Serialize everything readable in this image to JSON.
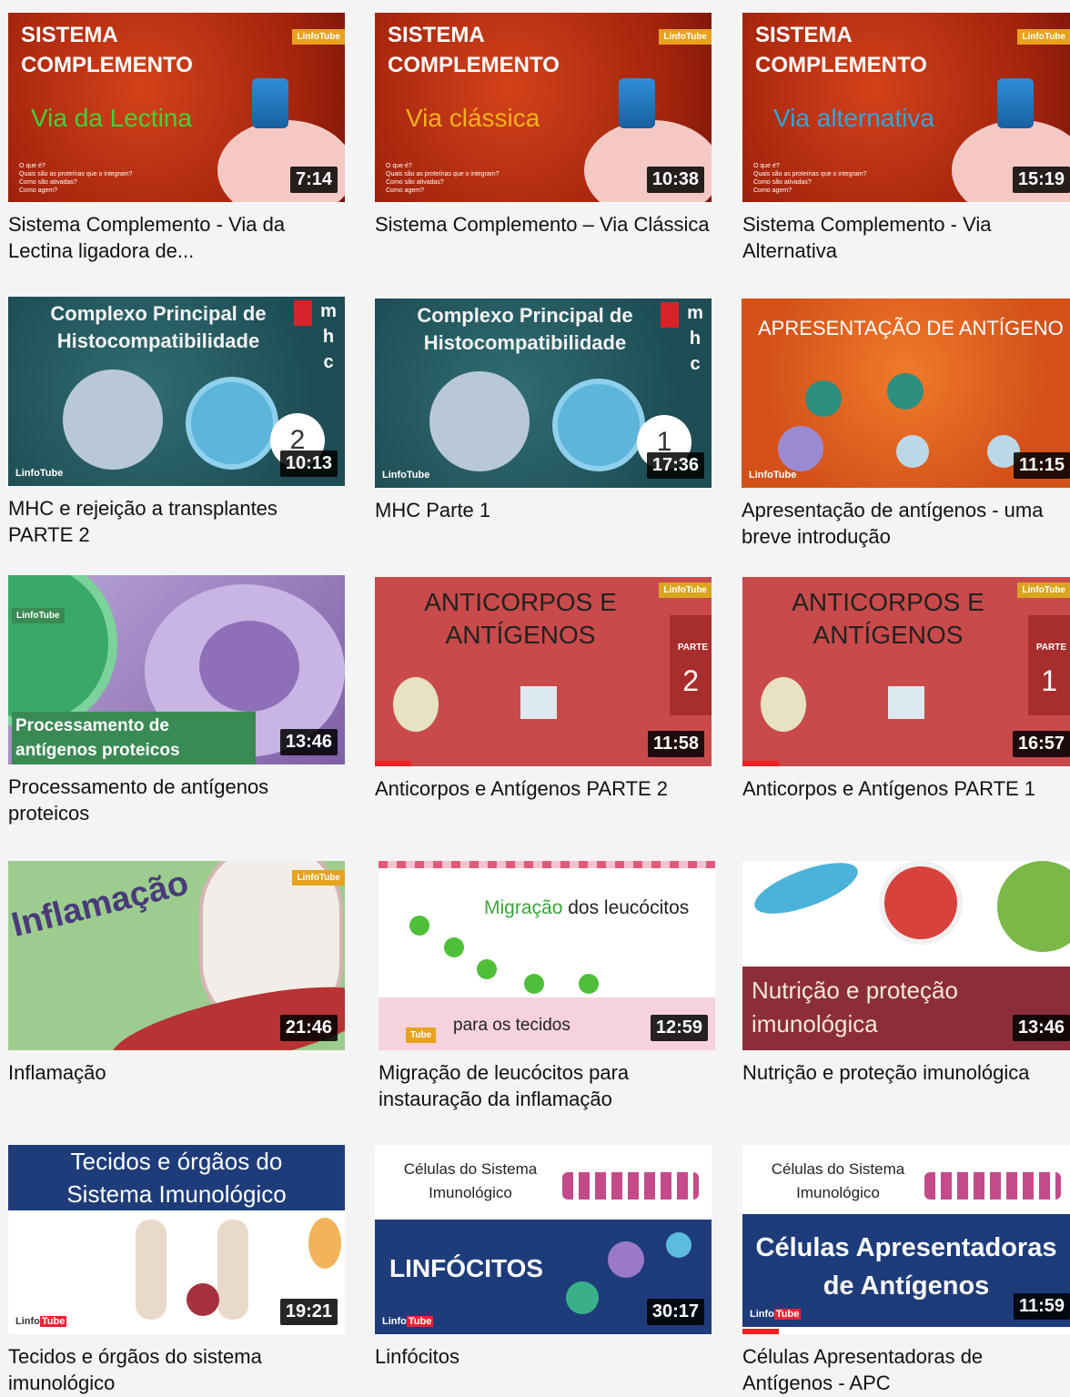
{
  "videos": [
    {
      "title": "Sistema Complemento - Via da Lectina ligadora de...",
      "duration": "7:14",
      "thumb_heading": "SISTEMA COMPLEMENTO",
      "thumb_sub": "Via da Lectina",
      "thumb_bullets": [
        "O que é?",
        "Quais são as proteínas que o integram?",
        "Como são ativadas?",
        "Como agem?"
      ]
    },
    {
      "title": "Sistema Complemento – Via Clássica",
      "duration": "10:38",
      "thumb_heading": "SISTEMA COMPLEMENTO",
      "thumb_sub": "Via clássica",
      "thumb_bullets": [
        "O que é?",
        "Quais são as proteínas que o integram?",
        "Como são ativadas?",
        "Como agem?"
      ]
    },
    {
      "title": "Sistema Complemento - Via Alternativa",
      "duration": "15:19",
      "thumb_heading": "SISTEMA COMPLEMENTO",
      "thumb_sub": "Via alternativa",
      "thumb_bullets": [
        "O que é?",
        "Quais são as proteínas que o integram?",
        "Como são ativadas?",
        "Como agem?"
      ]
    },
    {
      "title": "MHC e rejeição a transplantes PARTE 2",
      "duration": "10:13",
      "thumb_heading": "Complexo Principal de Histocompatibilidade",
      "thumb_side": "m h c",
      "thumb_num": "2"
    },
    {
      "title": "MHC Parte 1",
      "duration": "17:36",
      "thumb_heading": "Complexo Principal de Histocompatibilidade",
      "thumb_side": "m h c",
      "thumb_num": "1"
    },
    {
      "title": "Apresentação de antígenos - uma breve introdução",
      "duration": "11:15",
      "thumb_heading": "APRESENTAÇÃO DE ANTÍGENO"
    },
    {
      "title": "Processamento de antígenos proteicos",
      "duration": "13:46",
      "thumb_heading": "Processamento de antígenos proteicos"
    },
    {
      "title": "Anticorpos e Antígenos PARTE 2",
      "duration": "11:58",
      "thumb_heading": "ANTICORPOS E ANTÍGENOS",
      "thumb_part": "PARTE",
      "thumb_num": "2"
    },
    {
      "title": "Anticorpos e Antígenos PARTE 1",
      "duration": "16:57",
      "thumb_heading": "ANTICORPOS E ANTÍGENOS",
      "thumb_part": "PARTE",
      "thumb_num": "1"
    },
    {
      "title": "Inflamação",
      "duration": "21:46",
      "thumb_heading": "Inflamação"
    },
    {
      "title": "Migração de leucócitos para instauração da inflamação",
      "duration": "12:59",
      "thumb_heading_a": "Migração",
      "thumb_heading_b": " dos leucócitos",
      "thumb_sub": "para os tecidos"
    },
    {
      "title": "Nutrição e proteção imunológica",
      "duration": "13:46",
      "thumb_heading": "Nutrição e proteção imunológica"
    },
    {
      "title": "Tecidos e órgãos do sistema imunológico",
      "duration": "19:21",
      "thumb_heading": "Tecidos e órgãos do Sistema Imunológico"
    },
    {
      "title": "Linfócitos",
      "duration": "30:17",
      "thumb_heading": "Células do Sistema Imunológico",
      "thumb_sub": "LINFÓCITOS"
    },
    {
      "title": "Células Apresentadoras de Antígenos - APC",
      "duration": "11:59",
      "thumb_heading": "Células do Sistema Imunológico",
      "thumb_sub": "Células Apresentadoras de Antígenos"
    }
  ],
  "brand": {
    "logo_a": "Linfo",
    "logo_b": "Tube"
  }
}
